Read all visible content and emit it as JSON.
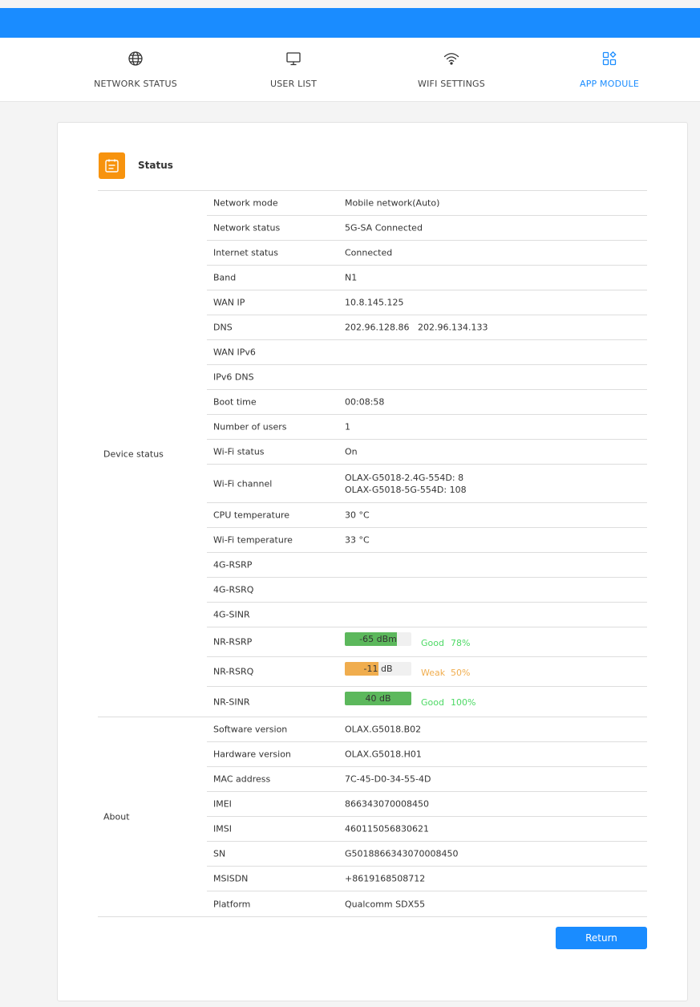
{
  "nav": {
    "items": [
      {
        "label": "NETWORK STATUS",
        "icon": "globe-icon",
        "active": false
      },
      {
        "label": "USER LIST",
        "icon": "monitor-icon",
        "active": false
      },
      {
        "label": "WIFI SETTINGS",
        "icon": "wifi-icon",
        "active": false
      },
      {
        "label": "APP MODULE",
        "icon": "app-grid-icon",
        "active": true
      }
    ],
    "accent": "#1a8cff"
  },
  "status": {
    "title": "Status",
    "icon": "calendar-list-icon",
    "icon_color": "#f7930e"
  },
  "device_status": {
    "label": "Device status",
    "rows": [
      {
        "label": "Network mode",
        "value": "Mobile network(Auto)"
      },
      {
        "label": "Network status",
        "value": "5G-SA Connected"
      },
      {
        "label": "Internet status",
        "value": "Connected"
      },
      {
        "label": "Band",
        "value": "N1"
      },
      {
        "label": "WAN IP",
        "value": "10.8.145.125"
      },
      {
        "label": "DNS",
        "value": "202.96.128.86   202.96.134.133"
      },
      {
        "label": "WAN IPv6",
        "value": ""
      },
      {
        "label": "IPv6 DNS",
        "value": ""
      },
      {
        "label": "Boot time",
        "value": "00:08:58"
      },
      {
        "label": "Number of users",
        "value": "1"
      },
      {
        "label": "Wi-Fi status",
        "value": "On"
      },
      {
        "label": "Wi-Fi channel",
        "value_line1": "OLAX-G5018-2.4G-554D: 8",
        "value_line2": "OLAX-G5018-5G-554D: 108"
      },
      {
        "label": "CPU temperature",
        "value": "30 °C"
      },
      {
        "label": "Wi-Fi temperature",
        "value": "33 °C"
      },
      {
        "label": "4G-RSRP",
        "value": ""
      },
      {
        "label": "4G-RSRQ",
        "value": ""
      },
      {
        "label": "4G-SINR",
        "value": ""
      }
    ],
    "signals": [
      {
        "label": "NR-RSRP",
        "bar_text": "-65 dBm",
        "fraction": 0.78,
        "quality": "Good",
        "percent": "78%",
        "color": "#5cb85c",
        "text_color": "#4cd964"
      },
      {
        "label": "NR-RSRQ",
        "bar_text": "-11 dB",
        "fraction": 0.5,
        "quality": "Weak",
        "percent": "50%",
        "color": "#f0ad4e",
        "text_color": "#f0ad4e"
      },
      {
        "label": "NR-SINR",
        "bar_text": "40 dB",
        "fraction": 1.0,
        "quality": "Good",
        "percent": "100%",
        "color": "#5cb85c",
        "text_color": "#4cd964"
      }
    ]
  },
  "about": {
    "label": "About",
    "rows": [
      {
        "label": "Software version",
        "value": "OLAX.G5018.B02"
      },
      {
        "label": "Hardware version",
        "value": "OLAX.G5018.H01"
      },
      {
        "label": "MAC address",
        "value": "7C-45-D0-34-55-4D"
      },
      {
        "label": "IMEI",
        "value": "866343070008450"
      },
      {
        "label": "IMSI",
        "value": "460115056830621"
      },
      {
        "label": "SN",
        "value": "G5018866343070008450"
      },
      {
        "label": "MSISDN",
        "value": "+8619168508712"
      },
      {
        "label": "Platform",
        "value": "Qualcomm SDX55"
      }
    ]
  },
  "actions": {
    "return_label": "Return"
  }
}
